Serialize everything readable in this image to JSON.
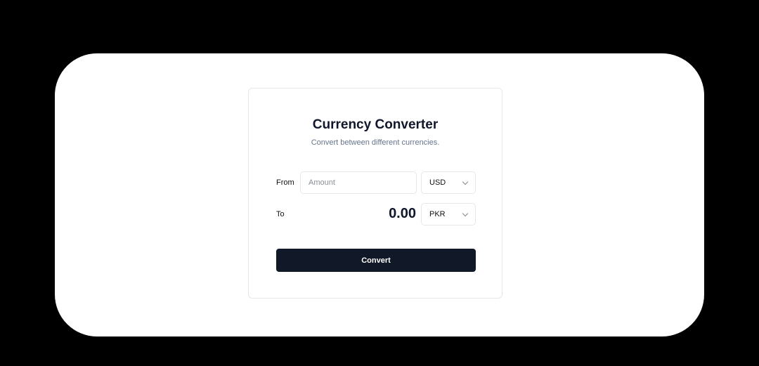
{
  "converter": {
    "title": "Currency Converter",
    "subtitle": "Convert between different currencies.",
    "from_label": "From",
    "amount_placeholder": "Amount",
    "from_currency": "USD",
    "to_label": "To",
    "result": "0.00",
    "to_currency": "PKR",
    "convert_label": "Convert"
  }
}
